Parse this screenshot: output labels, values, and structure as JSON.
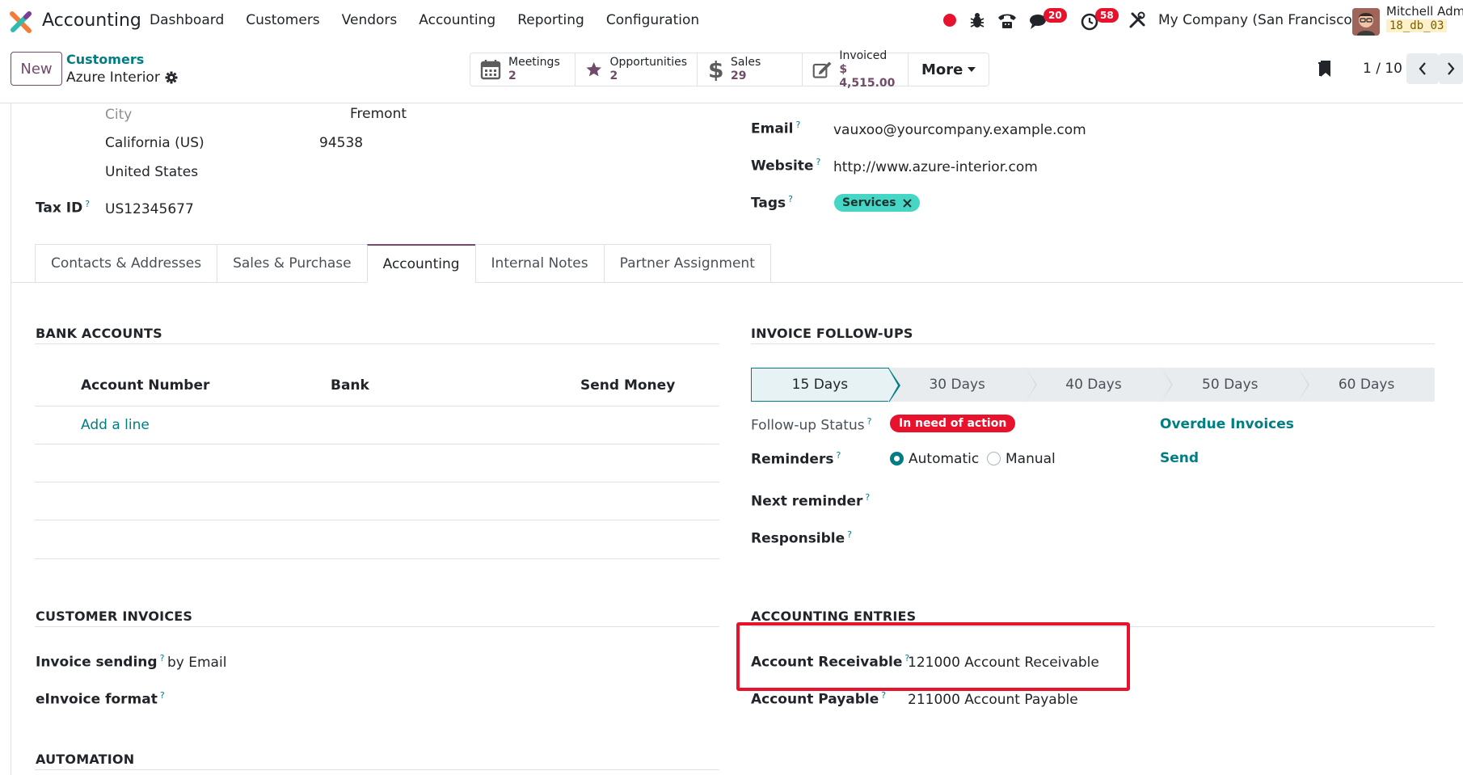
{
  "navbar": {
    "app_name": "Accounting",
    "menu": [
      "Dashboard",
      "Customers",
      "Vendors",
      "Accounting",
      "Reporting",
      "Configuration"
    ],
    "messages_count": "20",
    "activities_count": "58",
    "company": "My Company (San Francisco)",
    "user_name": "Mitchell Admi",
    "db_name": "18_db_03"
  },
  "control": {
    "new_label": "New",
    "breadcrumb_parent": "Customers",
    "breadcrumb_current": "Azure Interior",
    "smart_buttons": [
      {
        "label": "Meetings",
        "value": "2"
      },
      {
        "label": "Opportunities",
        "value": "2"
      },
      {
        "label": "Sales",
        "value": "29"
      },
      {
        "label": "Invoiced",
        "value": "$ 4,515.00"
      }
    ],
    "more_label": "More",
    "pager": "1 / 10"
  },
  "address": {
    "city_placeholder": "City",
    "city": "Fremont",
    "state": "California (US)",
    "zip": "94538",
    "country": "United States"
  },
  "fields": {
    "tax_id_label": "Tax ID",
    "tax_id": "US12345677",
    "email_label": "Email",
    "email": "vauxoo@yourcompany.example.com",
    "website_label": "Website",
    "website": "http://www.azure-interior.com",
    "tags_label": "Tags",
    "tag": "Services"
  },
  "tabs": [
    "Contacts & Addresses",
    "Sales & Purchase",
    "Accounting",
    "Internal Notes",
    "Partner Assignment"
  ],
  "bank_accounts": {
    "title": "BANK ACCOUNTS",
    "columns": [
      "Account Number",
      "Bank",
      "Send Money"
    ],
    "add_line": "Add a line"
  },
  "followups": {
    "title": "INVOICE FOLLOW-UPS",
    "steps": [
      "15 Days",
      "30 Days",
      "40 Days",
      "50 Days",
      "60 Days"
    ],
    "status_label": "Follow-up Status",
    "status": "In need of action",
    "overdue_link": "Overdue Invoices",
    "reminders_label": "Reminders",
    "reminder_auto": "Automatic",
    "reminder_manual": "Manual",
    "send_link": "Send",
    "next_reminder_label": "Next reminder",
    "responsible_label": "Responsible"
  },
  "customer_invoices": {
    "title": "CUSTOMER INVOICES",
    "sending_label": "Invoice sending",
    "sending_value": "by Email",
    "einvoice_label": "eInvoice format"
  },
  "accounting_entries": {
    "title": "ACCOUNTING ENTRIES",
    "receivable_label": "Account Receivable",
    "receivable_value": "121000 Account Receivable",
    "payable_label": "Account Payable",
    "payable_value": "211000 Account Payable"
  },
  "automation": {
    "title": "AUTOMATION"
  },
  "colors": {
    "brand": "#714b67",
    "accent": "#017e84",
    "danger": "#e8122c",
    "tag": "#46d6c5"
  }
}
